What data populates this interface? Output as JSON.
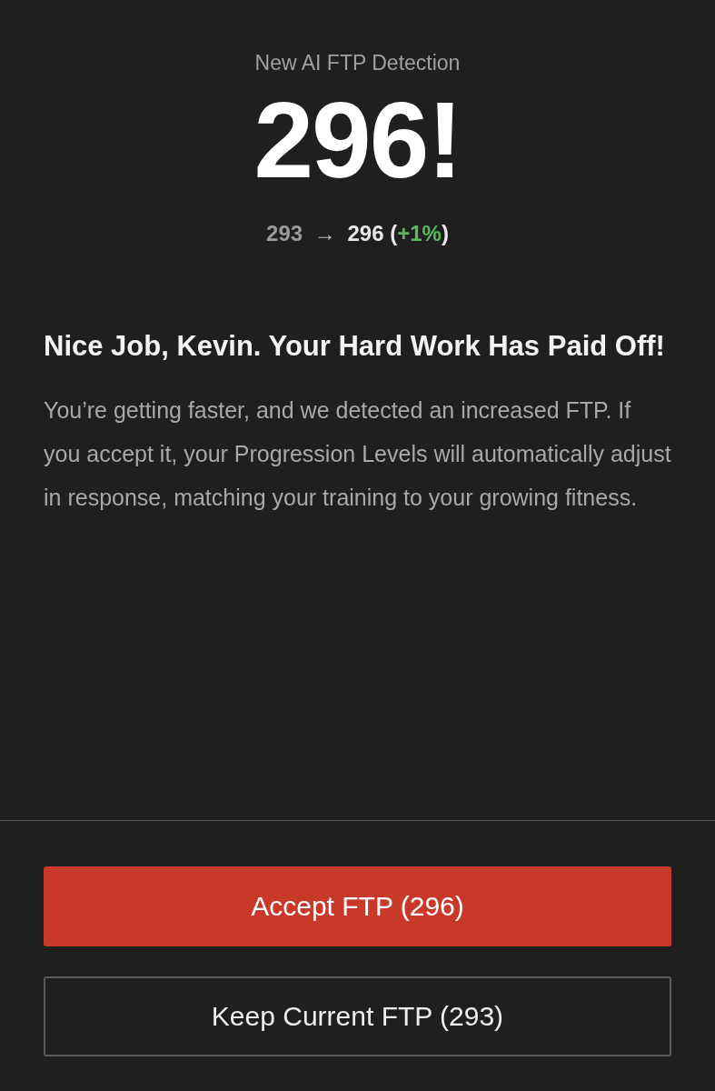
{
  "detection": {
    "label": "New AI FTP Detection",
    "value": "296!",
    "change": {
      "from": "293",
      "arrow": "→",
      "to": "296",
      "delta_open": "(",
      "delta": "+1%",
      "delta_close": ")"
    }
  },
  "message": {
    "headline": "Nice Job, Kevin. Your Hard Work Has Paid Off!",
    "body": "You’re getting faster, and we detected an increased FTP. If you accept it, your Progression Levels will automatically adjust in response, matching your training to your growing fitness."
  },
  "buttons": [
    {
      "kind": "primary",
      "label": "Accept FTP (296)"
    },
    {
      "kind": "secondary",
      "label": "Keep Current FTP (293)"
    }
  ]
}
